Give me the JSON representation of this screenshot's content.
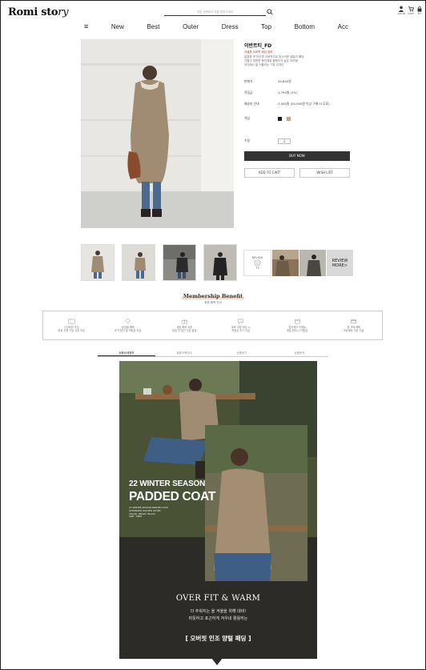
{
  "header": {
    "logo": "Romi story",
    "search_placeholder": "지금 검색하고 쿠폰 받아가세요",
    "icons": [
      {
        "name": "user-icon",
        "label": "LOGIN"
      },
      {
        "name": "cart-icon",
        "label": "CART"
      },
      {
        "name": "lock-icon",
        "label": "MY"
      }
    ]
  },
  "nav": {
    "menu_icon": "≡",
    "items": [
      "New",
      "Best",
      "Outer",
      "Dress",
      "Top",
      "Bottom",
      "Acc"
    ]
  },
  "product": {
    "name": "이반트티_FD",
    "promo": "겨울용 오버핏 패딩 점퍼",
    "desc_lines": [
      "깔끔한 넥 라인과 오버핏으로 멋스러운 데일리 패딩",
      "가볍고 따뜻한 충전재로 활용도가 높은 아이템",
      "어디에나 잘 어울리는 기본 디자인"
    ],
    "price_label": "판매가",
    "price_value": "59,800원",
    "points_label": "적립금",
    "points_value": "1,794원 (3%)",
    "delivery_label": "배송비 안내",
    "delivery_value": "3,000원 (50,000원 이상 구매 시 무료)",
    "color_label": "색상",
    "colors": [
      "#1e1e1e",
      "#c9a48f"
    ],
    "qty_label": "수량",
    "qty_value": "1",
    "buy_label": "BUY NOW",
    "cart_label": "ADD TO CART",
    "wish_label": "WISH LIST"
  },
  "reviews": {
    "count_label": "REVIEW",
    "count": "75",
    "more_line1": "REVIEW",
    "more_line2": "MORE>"
  },
  "membership": {
    "title": "Membership Benefit",
    "subtitle": "회원 혜택 안내",
    "benefits": [
      {
        "icon": "coupon-icon",
        "line1": "신규회원 가입",
        "line2": "바로 사용 가능 쿠폰 지급"
      },
      {
        "icon": "diamond-icon",
        "line1": "등급별 혜택",
        "line2": "추가 할인 및 적립금 지급"
      },
      {
        "icon": "gift-icon",
        "line1": "생일 축하 쿠폰",
        "line2": "생일 월 할인 쿠폰 발급"
      },
      {
        "icon": "review-icon",
        "line1": "포토 리뷰 작성 시",
        "line2": "적립금 추가 지급"
      },
      {
        "icon": "calendar-icon",
        "line1": "출석체크 이벤트",
        "line2": "매일 참여 시 적립금"
      },
      {
        "icon": "card-icon",
        "line1": "첫 구매 혜택",
        "line2": "무료배송 쿠폰 지급"
      }
    ]
  },
  "tabs": [
    "상품상세정보",
    "상품구매안내",
    "상품후기",
    "상품문의"
  ],
  "banner": {
    "season": "22 WINTER SEASON",
    "coat": "PADDED COAT",
    "small_lines": [
      "22 WINTER SEASON PADDED COAT",
      "OVERSIZED QUILTED OUTER",
      "COLOR : BEIGE / BLACK",
      "SIZE : FREE"
    ],
    "headline": "OVER FIT & WARM",
    "kor_line1": "더 추워지는 올 겨울을 위해 대비!",
    "kor_line2": "따뜻하고 포근하게 겨우내 활용하는",
    "kor_line3": "[ 오버핏 인조 양털 패딩 ]"
  }
}
